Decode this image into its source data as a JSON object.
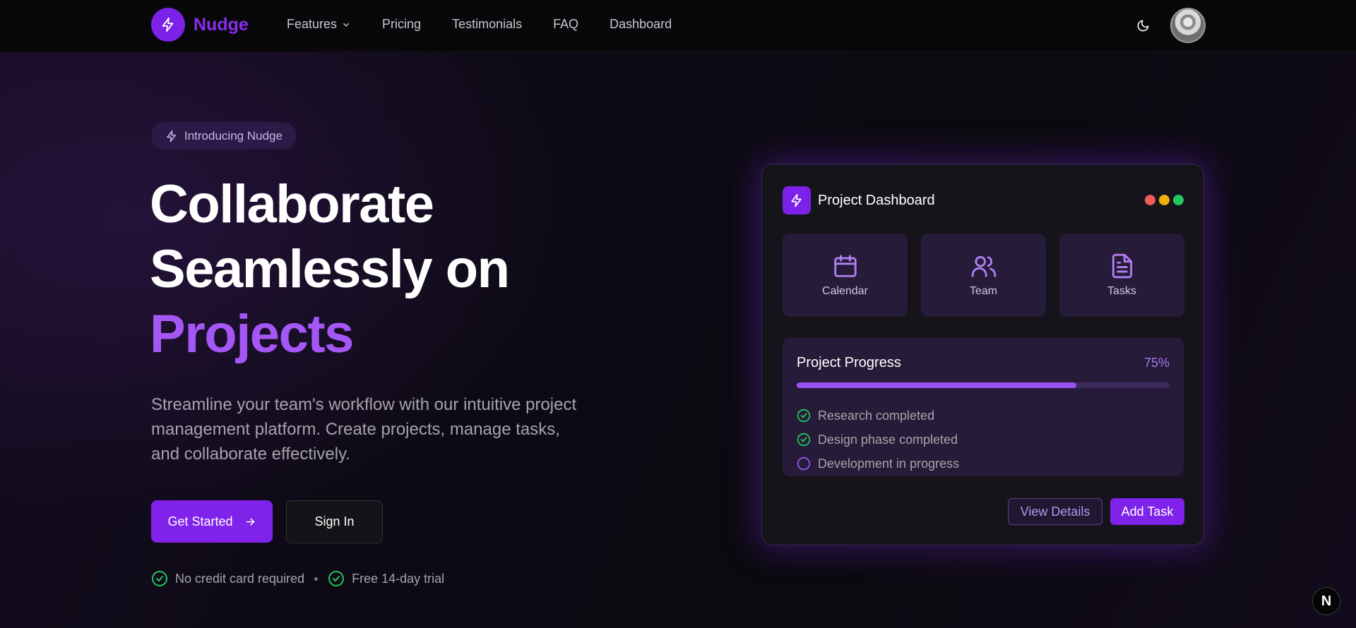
{
  "nav": {
    "brand": "Nudge",
    "links": [
      {
        "label": "Features"
      },
      {
        "label": "Pricing"
      },
      {
        "label": "Testimonials"
      },
      {
        "label": "FAQ"
      },
      {
        "label": "Dashboard"
      }
    ]
  },
  "hero": {
    "badge": "Introducing Nudge",
    "headline_line1": "Collaborate",
    "headline_line2": "Seamlessly on",
    "headline_line3": "Projects",
    "subtitle": "Streamline your team's workflow with our intuitive project management platform. Create projects, manage tasks, and collaborate effectively.",
    "primary_cta": "Get Started",
    "secondary_cta": "Sign In",
    "perks": [
      "No credit card required",
      "Free 14-day trial"
    ]
  },
  "dashboard": {
    "title": "Project Dashboard",
    "tiles": [
      {
        "label": "Calendar",
        "icon": "calendar-icon"
      },
      {
        "label": "Team",
        "icon": "users-icon"
      },
      {
        "label": "Tasks",
        "icon": "document-icon"
      }
    ],
    "progress": {
      "title": "Project Progress",
      "percent_label": "75%",
      "value": 0.75
    },
    "steps": [
      {
        "label": "Research completed",
        "status": "done"
      },
      {
        "label": "Design phase completed",
        "status": "done"
      },
      {
        "label": "Development in progress",
        "status": "pending"
      }
    ],
    "view_details": "View Details",
    "add_task": "Add Task"
  },
  "corner_badge": "N",
  "colors": {
    "accent": "#7f22ea",
    "accent_light": "#a457f5",
    "success": "#22c55e",
    "traffic_red": "#ef5a5a",
    "traffic_yellow": "#eab308",
    "traffic_green": "#22c55e"
  }
}
